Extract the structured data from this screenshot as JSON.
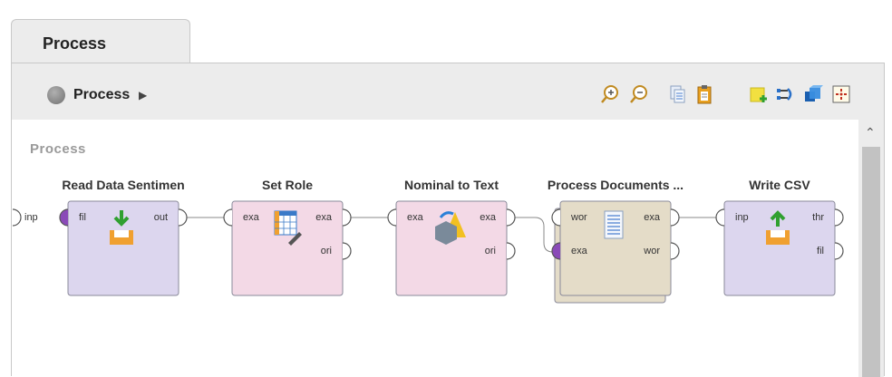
{
  "tab": {
    "label": "Process"
  },
  "breadcrumb": {
    "label": "Process"
  },
  "canvas": {
    "title": "Process"
  },
  "process_input_port": "inp",
  "operators": [
    {
      "name": "Read Data Sentimen",
      "inputs": [
        "fil"
      ],
      "outputs": [
        "out"
      ],
      "color": "#dcd6ee"
    },
    {
      "name": "Set Role",
      "inputs": [
        "exa"
      ],
      "outputs": [
        "exa",
        "ori"
      ],
      "color": "#f3d9e6"
    },
    {
      "name": "Nominal to Text",
      "inputs": [
        "exa"
      ],
      "outputs": [
        "exa",
        "ori"
      ],
      "color": "#f3d9e6"
    },
    {
      "name": "Process Documents ...",
      "inputs": [
        "wor",
        "exa"
      ],
      "outputs": [
        "exa",
        "wor"
      ],
      "color": "#e4dcc8"
    },
    {
      "name": "Write CSV",
      "inputs": [
        "inp"
      ],
      "outputs": [
        "thr",
        "fil"
      ],
      "color": "#dcd6ee"
    }
  ],
  "toolbar_icons": [
    "zoom-in-icon",
    "zoom-out-icon",
    "copy-icon",
    "paste-icon",
    "add-note-icon",
    "connect-icon",
    "layers-icon",
    "fit-view-icon"
  ]
}
